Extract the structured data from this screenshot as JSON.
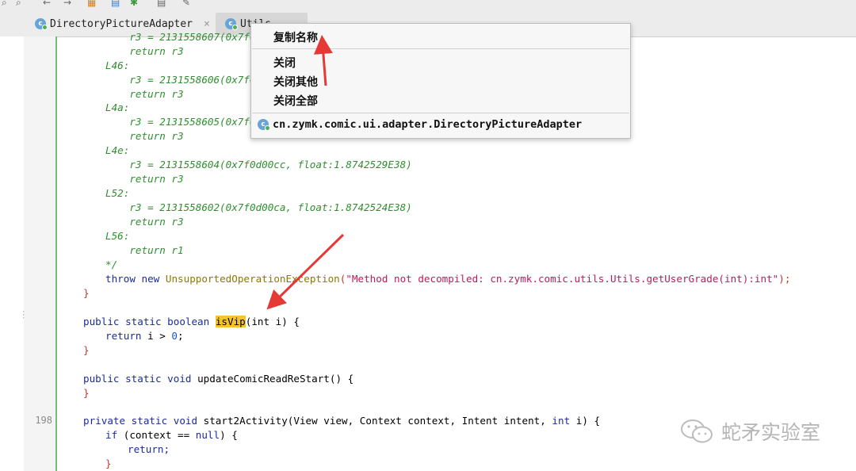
{
  "toolbar": {
    "icons": [
      "search-icon",
      "find-replace-icon",
      "back-arrow-icon",
      "forward-arrow-icon",
      "structure-icon",
      "export-icon",
      "debug-icon",
      "menu-icon",
      "settings-wrench-icon"
    ]
  },
  "tabs": [
    {
      "label": "DirectoryPictureAdapter",
      "close": "×",
      "active": false
    },
    {
      "label": "Utils",
      "active": true
    }
  ],
  "editor": {
    "line_numbers": {
      "start2Activity": "198"
    },
    "comment_lines": [
      "    r3 = 2131558607(0x7f0d",
      "    return r3",
      "L46:",
      "    r3 = 2131558606(0x7f0d",
      "    return r3",
      "L4a:",
      "    r3 = 2131558605(0x7f0d",
      "    return r3",
      "L4e:",
      "    r3 = 2131558604(0x7f0d00cc, float:1.8742529E38)",
      "    return r3",
      "L52:",
      "    r3 = 2131558602(0x7f0d00ca, float:1.8742524E38)",
      "    return r3",
      "L56:",
      "    return r1",
      "*/"
    ],
    "throw_line": {
      "kw1": "throw",
      "kw2": "new",
      "cls": "UnsupportedOperationException",
      "str": "\"Method not decompiled: cn.zymk.comic.utils.Utils.getUserGrade(int):int\"",
      "end": ");"
    },
    "close_brace": "}",
    "isvip": {
      "mods": "public static boolean",
      "name": "isVip",
      "params": "(int i) {",
      "body_kw": "return",
      "body_rest": " i > ",
      "body_num": "0",
      "body_end": ";"
    },
    "update": {
      "mods": "public static void",
      "rest": " updateComicReadReStart() {"
    },
    "start2": {
      "mods": "private static void",
      "rest": " start2Activity(View view, Context context, Intent intent, ",
      "kw_int": "int",
      "rest2": " i) {",
      "if_kw": "if",
      "if_rest": " (context == ",
      "null_kw": "null",
      "if_end": ") {",
      "ret": "return;",
      "close": "}"
    }
  },
  "context_menu": {
    "items": [
      "复制名称",
      "关闭",
      "关闭其他",
      "关闭全部"
    ],
    "path": "cn.zymk.comic.ui.adapter.DirectoryPictureAdapter"
  },
  "watermark": {
    "text": "蛇矛实验室"
  },
  "colors": {
    "arrow": "#e53935",
    "highlight": "#f4c430",
    "gutter_bar": "#72c06f"
  }
}
